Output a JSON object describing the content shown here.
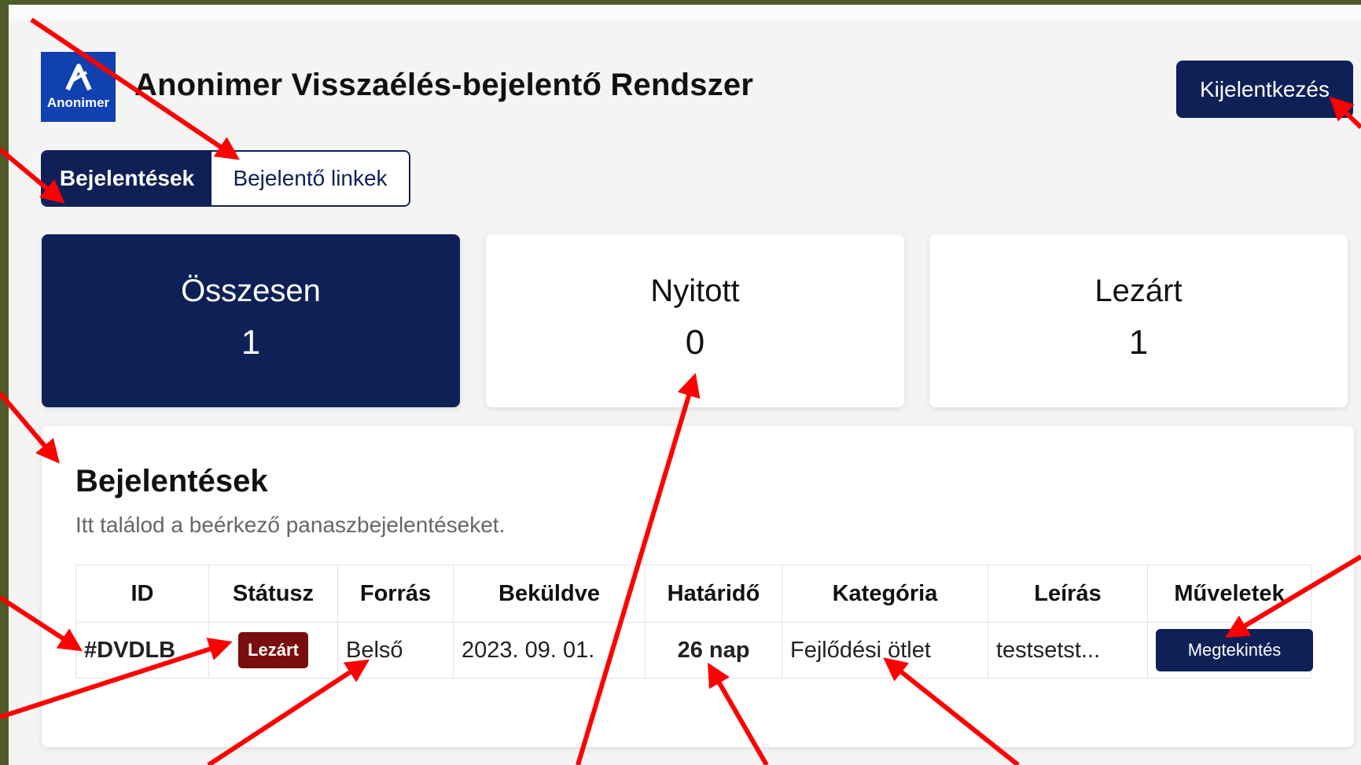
{
  "app": {
    "title": "Anonimer Visszaélés-bejelentő Rendszer",
    "logo_text": "Anonimer",
    "logout_label": "Kijelentkezés"
  },
  "tabs": [
    {
      "label": "Bejelentések",
      "active": true
    },
    {
      "label": "Bejelentő linkek",
      "active": false
    }
  ],
  "stats": [
    {
      "label": "Összesen",
      "value": "1"
    },
    {
      "label": "Nyitott",
      "value": "0"
    },
    {
      "label": "Lezárt",
      "value": "1"
    }
  ],
  "reports": {
    "title": "Bejelentések",
    "subtitle": "Itt találod a beérkező panaszbejelentéseket.",
    "columns": [
      "ID",
      "Státusz",
      "Forrás",
      "Beküldve",
      "Határidő",
      "Kategória",
      "Leírás",
      "Műveletek"
    ],
    "rows": [
      {
        "id": "#DVDLB",
        "status": "Lezárt",
        "source": "Belső",
        "submitted": "2023. 09. 01.",
        "deadline": "26 nap",
        "category": "Fejlődési ötlet",
        "description": "testsetst...",
        "action_label": "Megtekintés"
      }
    ]
  },
  "colors": {
    "navy": "#0f2057",
    "logo_blue": "#1140b0",
    "status_closed": "#7a0d0d",
    "annotation_arrow": "#ff0000",
    "background_frame": "#4e5a2a"
  },
  "icons": [
    "anonimer-logo-icon"
  ]
}
